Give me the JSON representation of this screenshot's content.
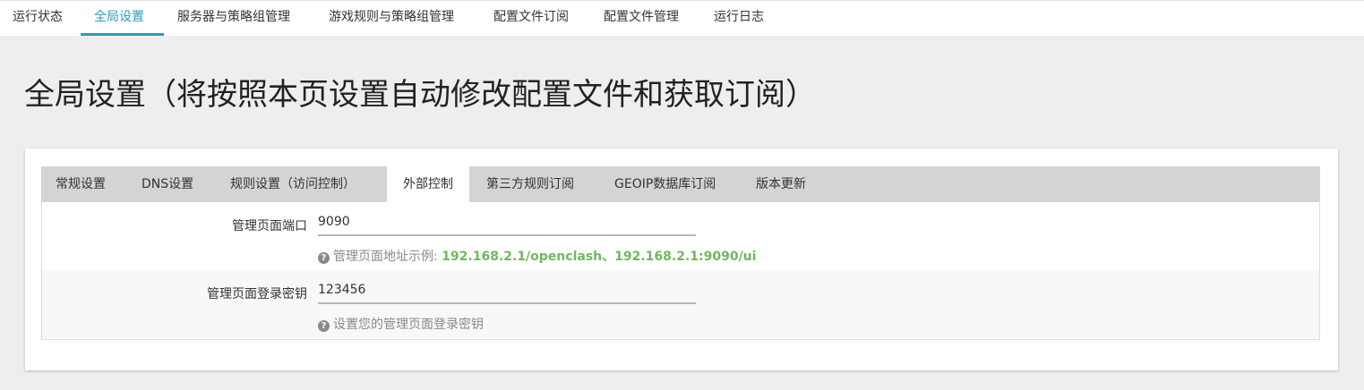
{
  "topnav": {
    "items": [
      {
        "label": "运行状态"
      },
      {
        "label": "全局设置"
      },
      {
        "label": "服务器与策略组管理"
      },
      {
        "label": "游戏规则与策略组管理"
      },
      {
        "label": "配置文件订阅"
      },
      {
        "label": "配置文件管理"
      },
      {
        "label": "运行日志"
      }
    ],
    "active_index": 1
  },
  "page": {
    "title": "全局设置（将按照本页设置自动修改配置文件和获取订阅）"
  },
  "tabs": {
    "items": [
      {
        "label": "常规设置"
      },
      {
        "label": "DNS设置"
      },
      {
        "label": "规则设置（访问控制）"
      },
      {
        "label": "外部控制"
      },
      {
        "label": "第三方规则订阅"
      },
      {
        "label": "GEOIP数据库订阅"
      },
      {
        "label": "版本更新"
      }
    ],
    "active_index": 3
  },
  "form": {
    "rows": [
      {
        "label": "管理页面端口",
        "value": "9090",
        "help_prefix": "管理页面地址示例: ",
        "help_link": "192.168.2.1/openclash、192.168.2.1:9090/ui"
      },
      {
        "label": "管理页面登录密钥",
        "value": "123456",
        "help_prefix": "设置您的管理页面登录密钥",
        "help_link": ""
      }
    ]
  },
  "icons": {
    "help": "question-circle-icon"
  },
  "colors": {
    "accent": "#2a9ac4",
    "help_link": "#6fb85f",
    "tabbar_bg": "#d4d4d4",
    "page_bg": "#eeeeee"
  }
}
